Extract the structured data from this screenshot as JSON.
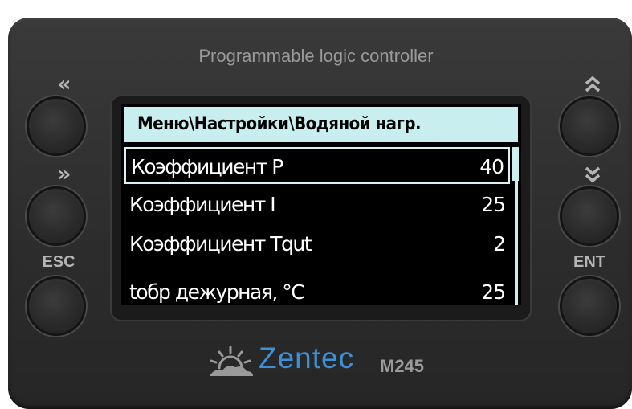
{
  "device": {
    "title": "Programmable logic controller",
    "brand": "Zentec",
    "model": "M245"
  },
  "buttons": {
    "left_top_symbol": "«",
    "left_mid_symbol": "»",
    "esc_label": "ESC",
    "right_top_symbol": "⌃⌃",
    "right_mid_symbol": "⌄⌄",
    "ent_label": "ENT"
  },
  "screen": {
    "breadcrumb": "Меню\\Настройки\\Водяной нагр.",
    "rows": [
      {
        "label": "Коэффициент P",
        "value": "40",
        "selected": true
      },
      {
        "label": "Коэффициент I",
        "value": "25",
        "selected": false
      },
      {
        "label": "Коэффициент Tqut",
        "value": "2",
        "selected": false
      },
      {
        "label": "tобр дежурная, °C",
        "value": "25",
        "selected": false
      }
    ]
  },
  "colors": {
    "header_bg": "#c8eef0",
    "brand": "#3e8fd6",
    "body": "#2f2f2f"
  }
}
